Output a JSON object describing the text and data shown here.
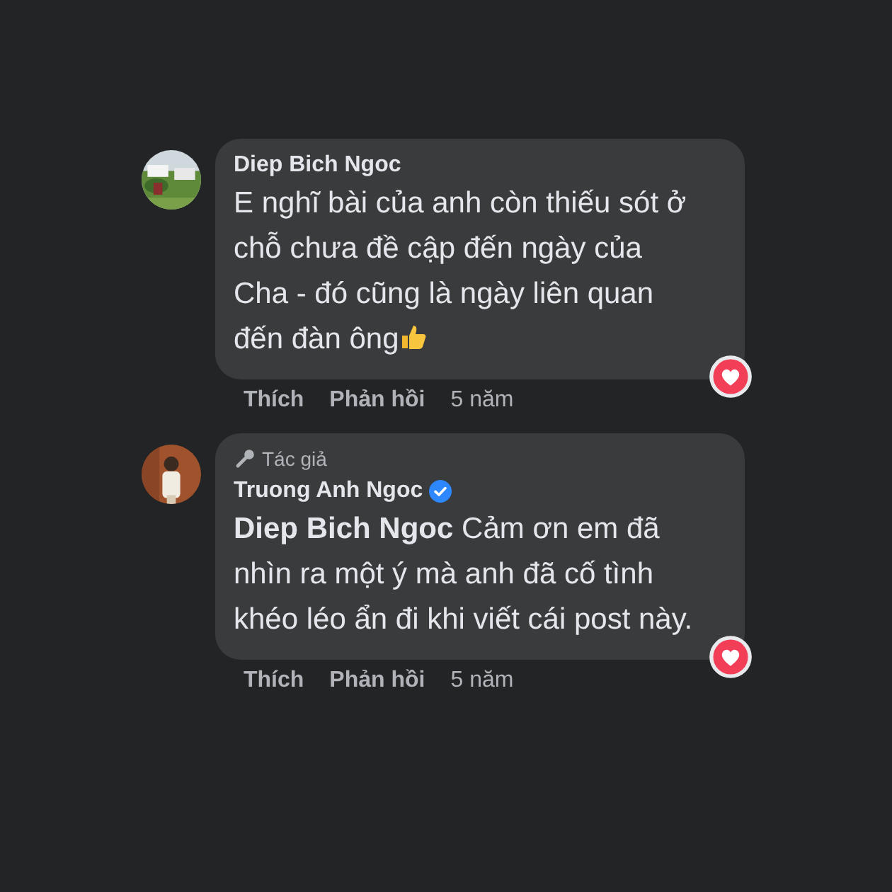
{
  "comments": [
    {
      "author": "Diep Bich Ngoc",
      "verified": false,
      "text": "E nghĩ bài của anh còn thiếu sót ở chỗ chưa đề cập đến ngày của Cha - đó cũng là ngày liên quan đến đàn ông",
      "ends_with_emoji": true,
      "reacted": true,
      "actions": [
        "Thích",
        "Phản hồi"
      ],
      "time": "5 năm"
    },
    {
      "author": "Truong Anh Ngoc",
      "badge": "Tác giả",
      "verified": true,
      "text": "**Diep Bich Ngoc** Cảm ơn em đã nhìn ra một ý mà anh đã cố tình khéo léo ẩn đi khi viết cái post này.",
      "ends_with_emoji": false,
      "reacted": true,
      "actions": [
        "Thích",
        "Phản hồi"
      ],
      "time": "5 năm"
    }
  ]
}
